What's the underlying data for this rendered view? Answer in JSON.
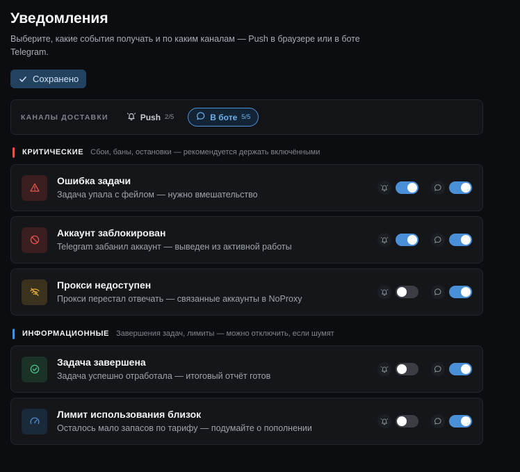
{
  "page": {
    "title": "Уведомления",
    "subtitle": "Выберите, какие события получать и по каким каналам — Push в браузере или в боте Telegram.",
    "saved_label": "Сохранено"
  },
  "channels": {
    "label": "КАНАЛЫ ДОСТАВКИ",
    "items": [
      {
        "label": "Push",
        "count": "2/5",
        "icon": "bell-icon",
        "active": false
      },
      {
        "label": "В боте",
        "count": "5/5",
        "icon": "chat-bubble-icon",
        "active": true
      }
    ]
  },
  "sections": [
    {
      "title": "КРИТИЧЕСКИЕ",
      "desc": "Сбои, баны, остановки — рекомендуется держать включёнными",
      "color": "#e5534b",
      "items": [
        {
          "title": "Ошибка задачи",
          "desc": "Задача упала с фейлом — нужно вмешательство",
          "icon": "warning-triangle-icon",
          "push": true,
          "bot": true
        },
        {
          "title": "Аккаунт заблокирован",
          "desc": "Telegram забанил аккаунт — выведен из активной работы",
          "icon": "ban-icon",
          "push": true,
          "bot": true
        },
        {
          "title": "Прокси недоступен",
          "desc": "Прокси перестал отвечать — связанные аккаунты в NoProxy",
          "icon": "wifi-off-icon",
          "push": false,
          "bot": true
        }
      ]
    },
    {
      "title": "ИНФОРМАЦИОННЫЕ",
      "desc": "Завершения задач, лимиты — можно отключить, если шумят",
      "color": "#4a90d9",
      "items": [
        {
          "title": "Задача завершена",
          "desc": "Задача успешно отработала — итоговый отчёт готов",
          "icon": "check-circle-icon",
          "push": false,
          "bot": true
        },
        {
          "title": "Лимит использования близок",
          "desc": "Осталось мало запасов по тарифу — подумайте о пополнении",
          "icon": "gauge-icon",
          "push": false,
          "bot": true
        }
      ]
    }
  ]
}
